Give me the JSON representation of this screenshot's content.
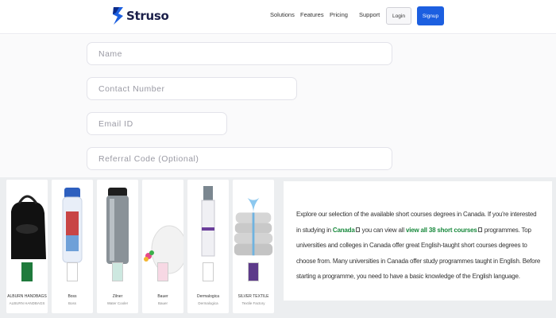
{
  "brand": {
    "name": "Struso",
    "logo_color": "#1c5fe0"
  },
  "nav": {
    "links": [
      "Solutions",
      "Features",
      "Pricing",
      "Support"
    ],
    "login_label": "Login",
    "signup_label": "Signup",
    "signup_color": "#1c5fe0"
  },
  "form": {
    "name_placeholder": "Name",
    "phone_placeholder": "Contact Number",
    "email_placeholder": "Email ID",
    "referral_placeholder": "Referral Code (Optional)"
  },
  "products": [
    {
      "name": "ALBURN HANDBAGS",
      "sub": "ALBURN HANDBAGS",
      "icon": "black-handbag"
    },
    {
      "name": "Boss",
      "sub": "Boss",
      "icon": "water-bottle"
    },
    {
      "name": "Zilner",
      "sub": "Water Cooler",
      "icon": "steel-flask"
    },
    {
      "name": "Bauer",
      "sub": "Bauer",
      "icon": "white-plate"
    },
    {
      "name": "Dermalogica",
      "sub": "Dermalogica",
      "icon": "serum-tube"
    },
    {
      "name": "SILVER TEXTILE",
      "sub": "Textile Factory",
      "icon": "towel-stack"
    }
  ],
  "description": {
    "part1": "Explore our selection of the available short courses degrees in Canada. If you're interested in studying in ",
    "link1": "Canada",
    "part2": " you can view all ",
    "link2": "view all 38 short courses",
    "part3": " programmes. Top universities and colleges in Canada offer great English-taught short courses degrees to choose from. Many universities in Canada offer study programmes taught in English. Before starting a programme, you need to have a basic knowledge of the English language.",
    "link_color": "#1a8a3e"
  }
}
